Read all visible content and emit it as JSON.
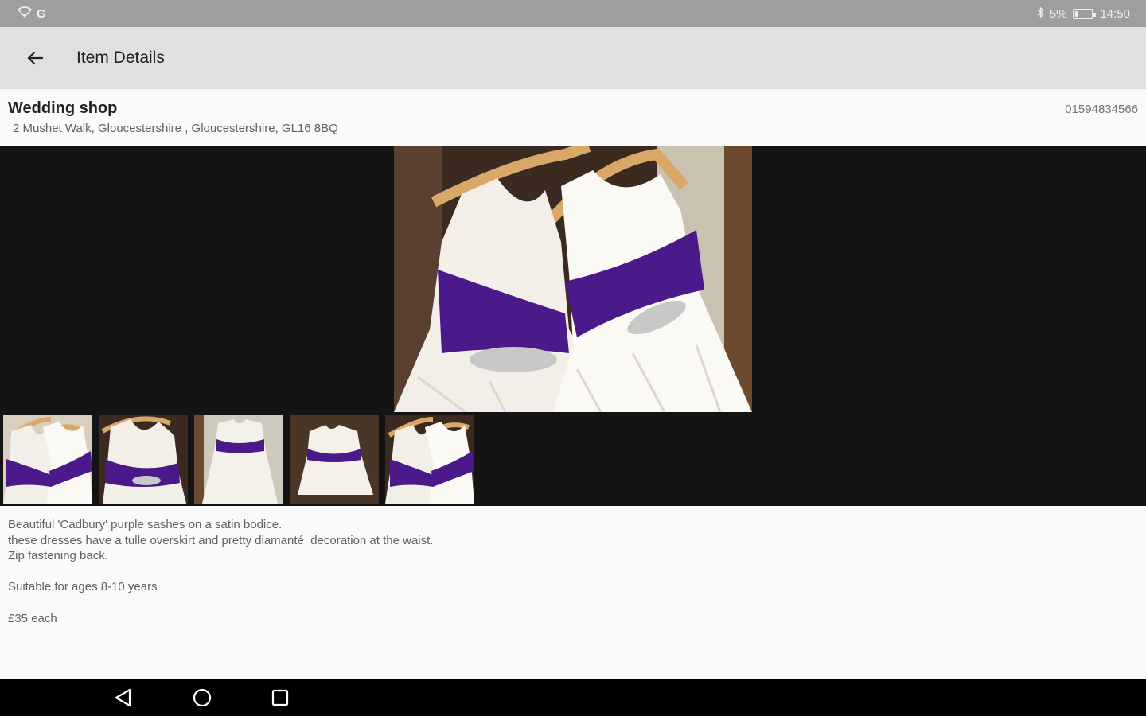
{
  "status_bar": {
    "left_text": "G",
    "battery_text": "5%",
    "time": "14:50"
  },
  "app_bar": {
    "title": "Item Details",
    "back_icon": "arrow-left-icon"
  },
  "shop": {
    "name": "Wedding shop",
    "address": "2 Mushet Walk, Gloucestershire , Gloucestershire, GL16 8BQ",
    "phone": "01594834566"
  },
  "gallery": {
    "main_image": "two white flower girl dresses with purple sashes on wooden hangers",
    "thumbnail_count": 5
  },
  "description": {
    "lines": [
      "Beautiful 'Cadbury' purple sashes on a satin bodice.",
      "these dresses have a tulle overskirt and pretty diamanté  decoration at the waist.",
      "Zip fastening back.",
      "",
      "Suitable for ages 8-10 years",
      "",
      "£35 each"
    ]
  },
  "nav_bar": {
    "back_icon": "triangle-back-icon",
    "home_icon": "circle-home-icon",
    "recents_icon": "square-recents-icon"
  },
  "colors": {
    "sash_purple": "#4a1a8a",
    "dress_white": "#f2efe8",
    "hanger_wood": "#d9a868"
  }
}
